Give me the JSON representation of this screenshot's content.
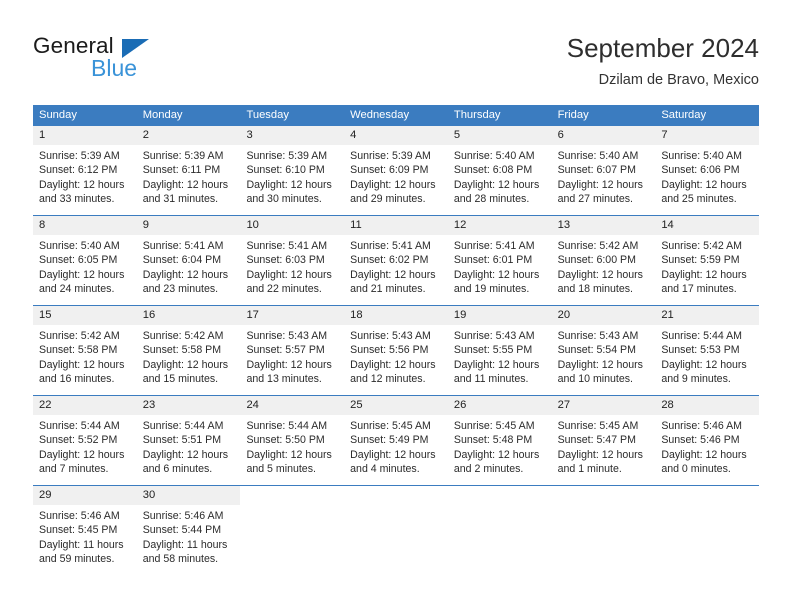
{
  "brand": {
    "word_one": "General",
    "word_two": "Blue",
    "triangle_icon": "blue-triangle-logo-mark",
    "color_dark": "#1b1b1b",
    "color_blue": "#3a93d8",
    "color_triangle": "#1a6cb5"
  },
  "header": {
    "title": "September 2024",
    "subtitle": "Dzilam de Bravo, Mexico"
  },
  "theme": {
    "header_blue": "#3b7cc0",
    "daynum_band": "#f0f0f0",
    "text": "#2b2b2b"
  },
  "weekdays": [
    "Sunday",
    "Monday",
    "Tuesday",
    "Wednesday",
    "Thursday",
    "Friday",
    "Saturday"
  ],
  "weeks": [
    [
      {
        "day": "1",
        "sunrise": "Sunrise: 5:39 AM",
        "sunset": "Sunset: 6:12 PM",
        "daylight_1": "Daylight: 12 hours",
        "daylight_2": "and 33 minutes."
      },
      {
        "day": "2",
        "sunrise": "Sunrise: 5:39 AM",
        "sunset": "Sunset: 6:11 PM",
        "daylight_1": "Daylight: 12 hours",
        "daylight_2": "and 31 minutes."
      },
      {
        "day": "3",
        "sunrise": "Sunrise: 5:39 AM",
        "sunset": "Sunset: 6:10 PM",
        "daylight_1": "Daylight: 12 hours",
        "daylight_2": "and 30 minutes."
      },
      {
        "day": "4",
        "sunrise": "Sunrise: 5:39 AM",
        "sunset": "Sunset: 6:09 PM",
        "daylight_1": "Daylight: 12 hours",
        "daylight_2": "and 29 minutes."
      },
      {
        "day": "5",
        "sunrise": "Sunrise: 5:40 AM",
        "sunset": "Sunset: 6:08 PM",
        "daylight_1": "Daylight: 12 hours",
        "daylight_2": "and 28 minutes."
      },
      {
        "day": "6",
        "sunrise": "Sunrise: 5:40 AM",
        "sunset": "Sunset: 6:07 PM",
        "daylight_1": "Daylight: 12 hours",
        "daylight_2": "and 27 minutes."
      },
      {
        "day": "7",
        "sunrise": "Sunrise: 5:40 AM",
        "sunset": "Sunset: 6:06 PM",
        "daylight_1": "Daylight: 12 hours",
        "daylight_2": "and 25 minutes."
      }
    ],
    [
      {
        "day": "8",
        "sunrise": "Sunrise: 5:40 AM",
        "sunset": "Sunset: 6:05 PM",
        "daylight_1": "Daylight: 12 hours",
        "daylight_2": "and 24 minutes."
      },
      {
        "day": "9",
        "sunrise": "Sunrise: 5:41 AM",
        "sunset": "Sunset: 6:04 PM",
        "daylight_1": "Daylight: 12 hours",
        "daylight_2": "and 23 minutes."
      },
      {
        "day": "10",
        "sunrise": "Sunrise: 5:41 AM",
        "sunset": "Sunset: 6:03 PM",
        "daylight_1": "Daylight: 12 hours",
        "daylight_2": "and 22 minutes."
      },
      {
        "day": "11",
        "sunrise": "Sunrise: 5:41 AM",
        "sunset": "Sunset: 6:02 PM",
        "daylight_1": "Daylight: 12 hours",
        "daylight_2": "and 21 minutes."
      },
      {
        "day": "12",
        "sunrise": "Sunrise: 5:41 AM",
        "sunset": "Sunset: 6:01 PM",
        "daylight_1": "Daylight: 12 hours",
        "daylight_2": "and 19 minutes."
      },
      {
        "day": "13",
        "sunrise": "Sunrise: 5:42 AM",
        "sunset": "Sunset: 6:00 PM",
        "daylight_1": "Daylight: 12 hours",
        "daylight_2": "and 18 minutes."
      },
      {
        "day": "14",
        "sunrise": "Sunrise: 5:42 AM",
        "sunset": "Sunset: 5:59 PM",
        "daylight_1": "Daylight: 12 hours",
        "daylight_2": "and 17 minutes."
      }
    ],
    [
      {
        "day": "15",
        "sunrise": "Sunrise: 5:42 AM",
        "sunset": "Sunset: 5:58 PM",
        "daylight_1": "Daylight: 12 hours",
        "daylight_2": "and 16 minutes."
      },
      {
        "day": "16",
        "sunrise": "Sunrise: 5:42 AM",
        "sunset": "Sunset: 5:58 PM",
        "daylight_1": "Daylight: 12 hours",
        "daylight_2": "and 15 minutes."
      },
      {
        "day": "17",
        "sunrise": "Sunrise: 5:43 AM",
        "sunset": "Sunset: 5:57 PM",
        "daylight_1": "Daylight: 12 hours",
        "daylight_2": "and 13 minutes."
      },
      {
        "day": "18",
        "sunrise": "Sunrise: 5:43 AM",
        "sunset": "Sunset: 5:56 PM",
        "daylight_1": "Daylight: 12 hours",
        "daylight_2": "and 12 minutes."
      },
      {
        "day": "19",
        "sunrise": "Sunrise: 5:43 AM",
        "sunset": "Sunset: 5:55 PM",
        "daylight_1": "Daylight: 12 hours",
        "daylight_2": "and 11 minutes."
      },
      {
        "day": "20",
        "sunrise": "Sunrise: 5:43 AM",
        "sunset": "Sunset: 5:54 PM",
        "daylight_1": "Daylight: 12 hours",
        "daylight_2": "and 10 minutes."
      },
      {
        "day": "21",
        "sunrise": "Sunrise: 5:44 AM",
        "sunset": "Sunset: 5:53 PM",
        "daylight_1": "Daylight: 12 hours",
        "daylight_2": "and 9 minutes."
      }
    ],
    [
      {
        "day": "22",
        "sunrise": "Sunrise: 5:44 AM",
        "sunset": "Sunset: 5:52 PM",
        "daylight_1": "Daylight: 12 hours",
        "daylight_2": "and 7 minutes."
      },
      {
        "day": "23",
        "sunrise": "Sunrise: 5:44 AM",
        "sunset": "Sunset: 5:51 PM",
        "daylight_1": "Daylight: 12 hours",
        "daylight_2": "and 6 minutes."
      },
      {
        "day": "24",
        "sunrise": "Sunrise: 5:44 AM",
        "sunset": "Sunset: 5:50 PM",
        "daylight_1": "Daylight: 12 hours",
        "daylight_2": "and 5 minutes."
      },
      {
        "day": "25",
        "sunrise": "Sunrise: 5:45 AM",
        "sunset": "Sunset: 5:49 PM",
        "daylight_1": "Daylight: 12 hours",
        "daylight_2": "and 4 minutes."
      },
      {
        "day": "26",
        "sunrise": "Sunrise: 5:45 AM",
        "sunset": "Sunset: 5:48 PM",
        "daylight_1": "Daylight: 12 hours",
        "daylight_2": "and 2 minutes."
      },
      {
        "day": "27",
        "sunrise": "Sunrise: 5:45 AM",
        "sunset": "Sunset: 5:47 PM",
        "daylight_1": "Daylight: 12 hours",
        "daylight_2": "and 1 minute."
      },
      {
        "day": "28",
        "sunrise": "Sunrise: 5:46 AM",
        "sunset": "Sunset: 5:46 PM",
        "daylight_1": "Daylight: 12 hours",
        "daylight_2": "and 0 minutes."
      }
    ],
    [
      {
        "day": "29",
        "sunrise": "Sunrise: 5:46 AM",
        "sunset": "Sunset: 5:45 PM",
        "daylight_1": "Daylight: 11 hours",
        "daylight_2": "and 59 minutes."
      },
      {
        "day": "30",
        "sunrise": "Sunrise: 5:46 AM",
        "sunset": "Sunset: 5:44 PM",
        "daylight_1": "Daylight: 11 hours",
        "daylight_2": "and 58 minutes."
      },
      {
        "day": "",
        "sunrise": "",
        "sunset": "",
        "daylight_1": "",
        "daylight_2": ""
      },
      {
        "day": "",
        "sunrise": "",
        "sunset": "",
        "daylight_1": "",
        "daylight_2": ""
      },
      {
        "day": "",
        "sunrise": "",
        "sunset": "",
        "daylight_1": "",
        "daylight_2": ""
      },
      {
        "day": "",
        "sunrise": "",
        "sunset": "",
        "daylight_1": "",
        "daylight_2": ""
      },
      {
        "day": "",
        "sunrise": "",
        "sunset": "",
        "daylight_1": "",
        "daylight_2": ""
      }
    ]
  ]
}
